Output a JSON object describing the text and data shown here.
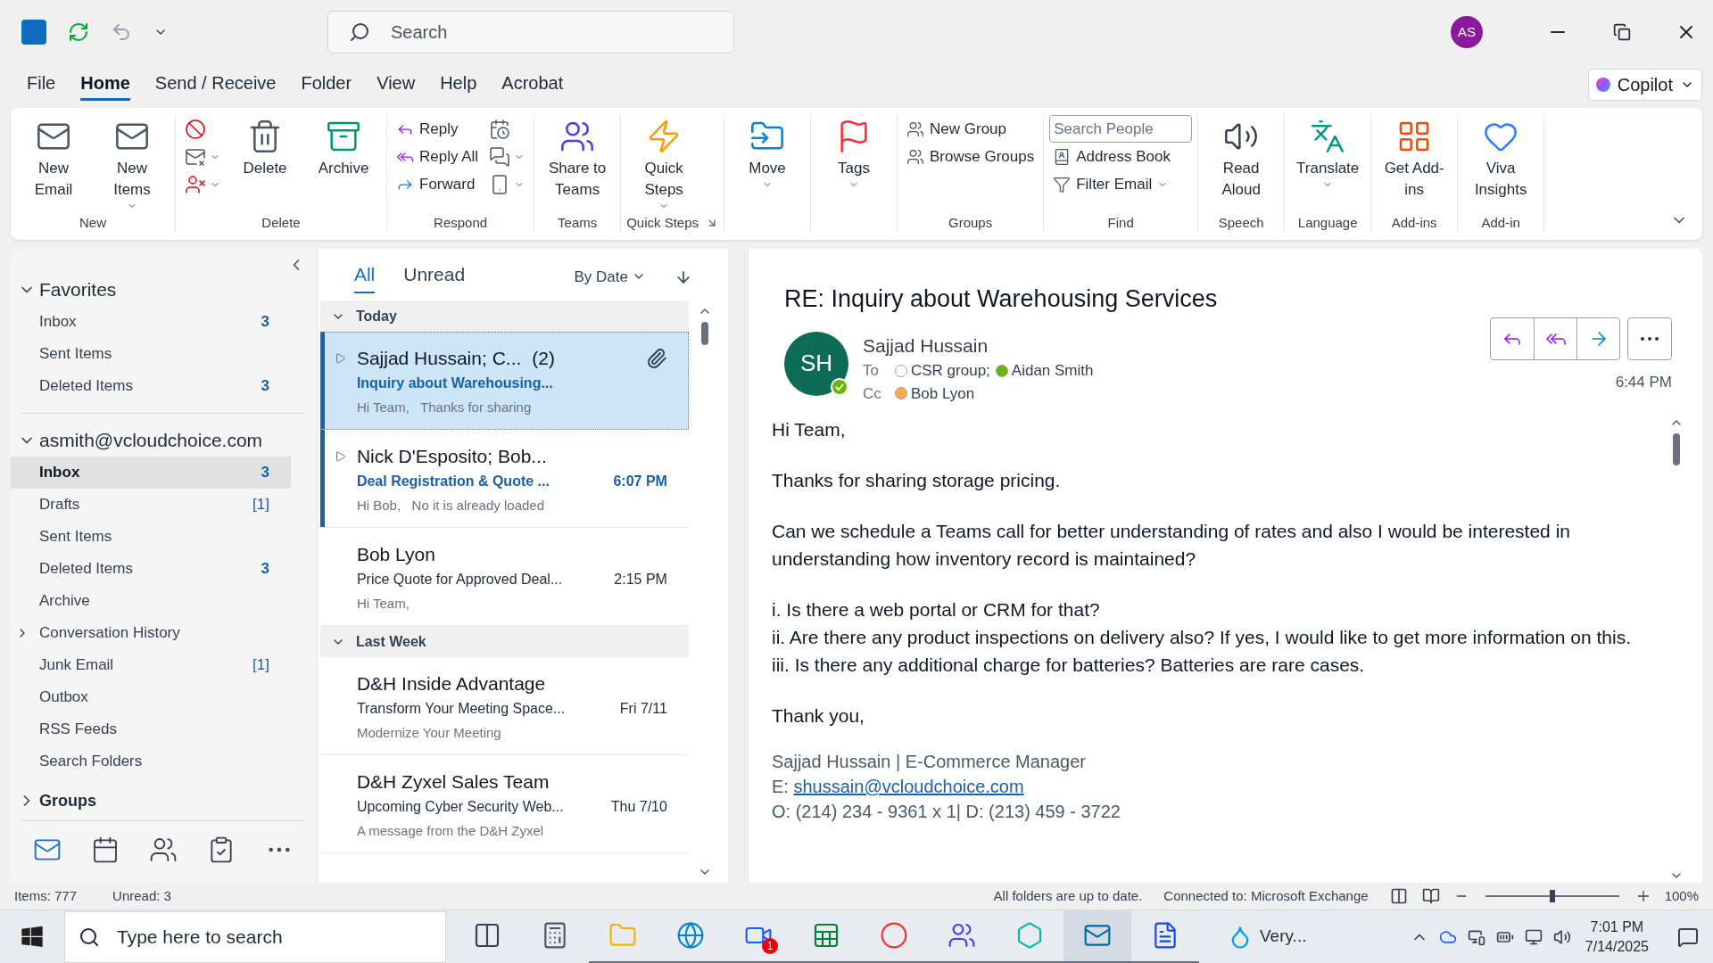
{
  "title_bar": {
    "search_placeholder": "Search",
    "avatar": "AS"
  },
  "menu_tabs": [
    {
      "label": "File",
      "selected": false
    },
    {
      "label": "Home",
      "selected": true
    },
    {
      "label": "Send / Receive",
      "selected": false
    },
    {
      "label": "Folder",
      "selected": false
    },
    {
      "label": "View",
      "selected": false
    },
    {
      "label": "Help",
      "selected": false
    },
    {
      "label": "Acrobat",
      "selected": false
    }
  ],
  "copilot": {
    "label": "Copilot"
  },
  "ribbon": {
    "groups": [
      {
        "label": "New",
        "columns": [
          [
            {
              "kind": "large",
              "label": "New Email"
            }
          ],
          [
            {
              "kind": "large",
              "label": "New Items",
              "dropdown": true
            }
          ]
        ]
      },
      {
        "label": "Delete",
        "columns": [
          [
            {
              "kind": "icon"
            },
            {
              "kind": "icon",
              "dropdown": true
            },
            {
              "kind": "icon",
              "dropdown": true
            }
          ],
          [
            {
              "kind": "large",
              "label": "Delete"
            }
          ],
          [
            {
              "kind": "large",
              "label": "Archive"
            }
          ]
        ]
      },
      {
        "label": "Respond",
        "columns": [
          [
            {
              "kind": "small",
              "label": "Reply"
            },
            {
              "kind": "small",
              "label": "Reply All"
            },
            {
              "kind": "small",
              "label": "Forward"
            }
          ],
          [
            {
              "kind": "icon"
            },
            {
              "kind": "icon",
              "dropdown": true
            },
            {
              "kind": "icon",
              "dropdown": true
            }
          ]
        ]
      },
      {
        "label": "Teams",
        "columns": [
          [
            {
              "kind": "large",
              "label": "Share to Teams"
            }
          ]
        ]
      },
      {
        "label": "Quick Steps",
        "launcher": true,
        "columns": [
          [
            {
              "kind": "large",
              "label": "Quick Steps",
              "dropdown": true
            }
          ]
        ]
      },
      {
        "columns": [
          [
            {
              "kind": "large",
              "label": "Move",
              "dropdown": true
            }
          ]
        ]
      },
      {
        "columns": [
          [
            {
              "kind": "large",
              "label": "Tags",
              "dropdown": true
            }
          ]
        ]
      },
      {
        "label": "Groups",
        "columns": [
          [
            {
              "kind": "small",
              "label": "New Group"
            },
            {
              "kind": "small",
              "label": "Browse Groups"
            }
          ]
        ]
      },
      {
        "label": "Find",
        "columns": [
          [
            {
              "kind": "field",
              "placeholder": "Search People"
            },
            {
              "kind": "small",
              "label": "Address Book"
            },
            {
              "kind": "small",
              "label": "Filter Email",
              "dropdown": true
            }
          ]
        ]
      },
      {
        "label": "Speech",
        "columns": [
          [
            {
              "kind": "large",
              "label": "Read Aloud"
            }
          ]
        ]
      },
      {
        "label": "Language",
        "columns": [
          [
            {
              "kind": "large",
              "label": "Translate",
              "dropdown": true
            }
          ]
        ]
      },
      {
        "label": "Add-ins",
        "columns": [
          [
            {
              "kind": "large",
              "label": "Get Add-ins"
            }
          ]
        ]
      },
      {
        "label": "Add-in",
        "columns": [
          [
            {
              "kind": "large",
              "label": "Viva Insights"
            }
          ]
        ]
      }
    ]
  },
  "folders": {
    "favorites": {
      "label": "Favorites",
      "expanded": true,
      "items": [
        {
          "label": "Inbox",
          "count": "3",
          "kind": "unread",
          "selected": false
        },
        {
          "label": "Sent Items",
          "selected": false
        },
        {
          "label": "Deleted Items",
          "count": "3",
          "kind": "unread",
          "selected": false
        }
      ]
    },
    "account": {
      "label": "asmith@vcloudchoice.com",
      "expanded": true,
      "items": [
        {
          "label": "Inbox",
          "count": "3",
          "kind": "unread",
          "selected": true
        },
        {
          "label": "Drafts",
          "count": "[1]",
          "kind": "total",
          "selected": false
        },
        {
          "label": "Sent Items",
          "selected": false
        },
        {
          "label": "Deleted Items",
          "count": "3",
          "kind": "unread",
          "selected": false
        },
        {
          "label": "Archive",
          "selected": false
        },
        {
          "label": "Conversation History",
          "expanded": false,
          "selected": false
        },
        {
          "label": "Junk Email",
          "count": "[1]",
          "kind": "total",
          "selected": false
        },
        {
          "label": "Outbox",
          "selected": false
        },
        {
          "label": "RSS Feeds",
          "selected": false
        },
        {
          "label": "Search Folders",
          "selected": false
        }
      ]
    },
    "groups": {
      "label": "Groups",
      "expanded": false
    }
  },
  "nav": [
    {
      "selected": true
    },
    {
      "selected": false
    },
    {
      "selected": false
    },
    {
      "selected": false
    },
    {
      "selected": false
    }
  ],
  "message_list": {
    "filters": [
      {
        "label": "All",
        "selected": true
      },
      {
        "label": "Unread",
        "selected": false
      }
    ],
    "sort": "By Date",
    "sections": [
      {
        "label": "Today",
        "expanded": true,
        "messages": [
          {
            "sender": "Sajjad Hussain;  C...",
            "count": "(2)",
            "subject": "Inquiry about Warehousing...",
            "preview": "Hi Team,   Thanks for sharing",
            "attachment": true,
            "thread": true,
            "unread": true,
            "selected": true
          },
          {
            "sender": "Nick D'Esposito;  Bob...",
            "subject": "Deal Registration & Quote ...",
            "preview": "Hi Bob,   No it is already loaded",
            "time": "6:07 PM",
            "thread": true,
            "unread": true,
            "selected": false
          },
          {
            "sender": "Bob Lyon",
            "subject": "Price Quote for Approved Deal...",
            "preview": "Hi Team,",
            "time": "2:15 PM",
            "unread": false,
            "selected": false
          }
        ]
      },
      {
        "label": "Last Week",
        "expanded": true,
        "messages": [
          {
            "sender": "D&H Inside Advantage",
            "subject": "Transform Your Meeting Space...",
            "preview": "Modernize Your Meeting",
            "time": "Fri 7/11",
            "unread": false,
            "selected": false
          },
          {
            "sender": "D&H Zyxel Sales Team",
            "subject": "Upcoming Cyber Security Web...",
            "preview": "A message from the D&H Zyxel",
            "time": "Thu 7/10",
            "unread": false,
            "selected": false
          }
        ]
      }
    ]
  },
  "reading_pane": {
    "subject": "RE: Inquiry about Warehousing Services",
    "initials": "SH",
    "sender": "Sajjad Hussain",
    "to_label": "To",
    "to": [
      {
        "name": "CSR group;",
        "color": "#ffffff"
      },
      {
        "name": "Aidan Smith",
        "color": "#6bb700"
      }
    ],
    "cc_label": "Cc",
    "cc": [
      {
        "name": "Bob Lyon",
        "color": "#ffaa44"
      }
    ],
    "time": "6:44 PM",
    "body": [
      [
        "Hi Team,"
      ],
      [
        "Thanks for sharing storage pricing."
      ],
      [
        "Can we schedule a Teams call for better understanding of rates and also I would be interested in understanding how inventory record is maintained?"
      ],
      [
        "i. Is there a web portal or CRM for that?",
        "ii. Are there any product inspections on delivery also? If yes, I would like to get more information on this.",
        "iii. Is there any additional charge for batteries? Batteries are rare cases."
      ],
      [
        "Thank you,"
      ]
    ],
    "signature": {
      "title": "Sajjad Hussain | E-Commerce Manager",
      "email_label": "E: ",
      "email": "shussain@vcloudchoice.com",
      "phone": "O: (214) 234 - 9361 x 1| D: (213) 459 - 3722"
    }
  },
  "status_bar": {
    "items": "Items: 777",
    "unread": "Unread: 3",
    "sync": "All folders are up to date.",
    "connection": "Connected to: Microsoft Exchange",
    "zoom": {
      "level": 0.5,
      "reading": "100%"
    }
  },
  "taskbar": {
    "search_placeholder": "Type here to search",
    "apps": [
      {
        "running": false,
        "active": false
      },
      {
        "running": false,
        "active": false
      },
      {
        "running": true,
        "active": false
      },
      {
        "running": true,
        "active": false
      },
      {
        "running": true,
        "active": false,
        "badge": "1"
      },
      {
        "running": true,
        "active": false
      },
      {
        "running": true,
        "active": false
      },
      {
        "running": true,
        "active": false
      },
      {
        "running": true,
        "active": false
      },
      {
        "running": true,
        "active": true
      },
      {
        "running": true,
        "active": false
      }
    ],
    "weather": "Very...",
    "time": "7:01 PM",
    "date": "7/14/2025"
  }
}
